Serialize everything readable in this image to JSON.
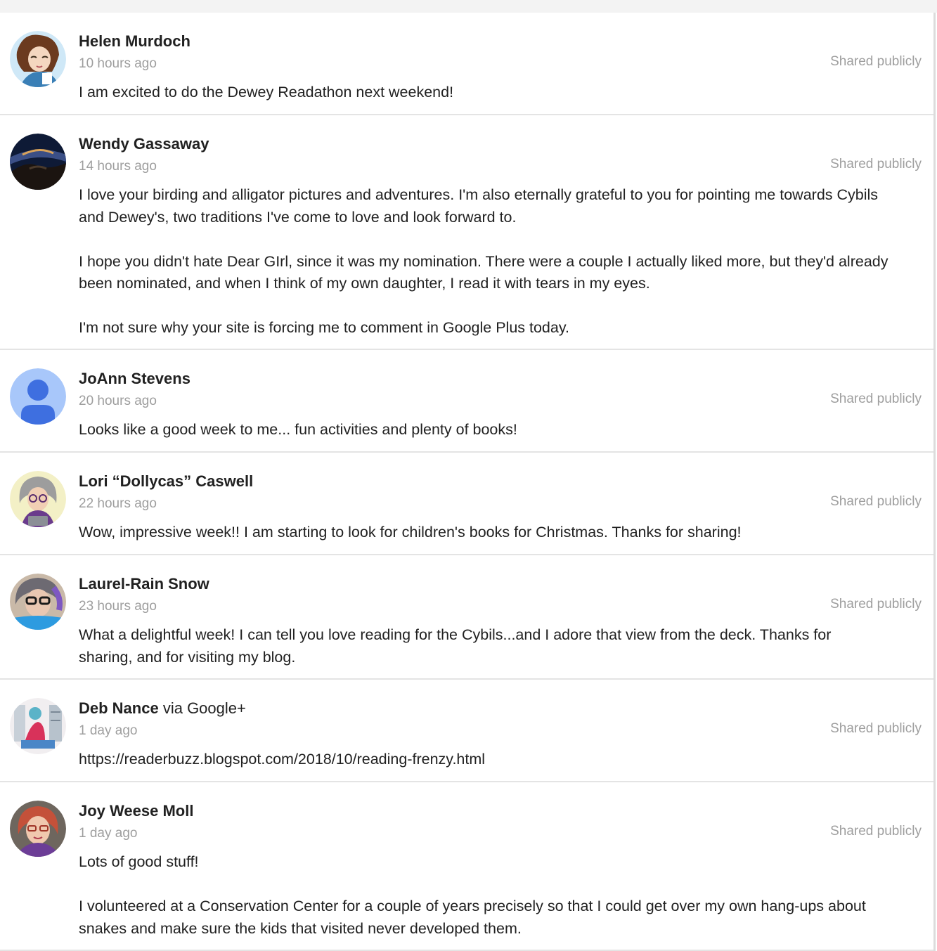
{
  "comments": [
    {
      "author": "Helen Murdoch",
      "time": "10 hours ago",
      "visibility": "Shared publicly",
      "avatar_icon": "cartoon-woman-avatar",
      "paragraphs": [
        [
          "I am excited to do the Dewey Readathon next weekend!"
        ]
      ]
    },
    {
      "author": "Wendy Gassaway",
      "time": "14 hours ago",
      "visibility": "Shared publicly",
      "avatar_icon": "night-landscape-avatar",
      "paragraphs": [
        [
          "I love your birding and alligator pictures and adventures. I'm also eternally grateful to you for pointing me towards Cybils",
          "and Dewey's, two traditions I've come to love and look forward to."
        ],
        [
          "I hope you didn't hate Dear GIrl, since it was my nomination. There were a couple I actually liked more, but they'd already",
          "been nominated, and when I think of my own daughter, I read it with tears in my eyes."
        ],
        [
          "I'm not sure why your site is forcing me to comment in Google Plus today."
        ]
      ]
    },
    {
      "author": "JoAnn Stevens",
      "time": "20 hours ago",
      "visibility": "Shared publicly",
      "avatar_icon": "default-user-avatar",
      "paragraphs": [
        [
          "Looks like a good week to me... fun activities and plenty of books!"
        ]
      ]
    },
    {
      "author": "Lori “Dollycas” Caswell",
      "time": "22 hours ago",
      "visibility": "Shared publicly",
      "avatar_icon": "cartoon-gray-hair-avatar",
      "paragraphs": [
        [
          "Wow, impressive week!! I am starting to look for children's books for Christmas. Thanks for sharing!"
        ]
      ]
    },
    {
      "author": "Laurel-Rain Snow",
      "time": "23 hours ago",
      "visibility": "Shared publicly",
      "avatar_icon": "photo-glasses-avatar",
      "paragraphs": [
        [
          "What a delightful week!  I can tell you love reading for the Cybils...and I adore that view from the deck.  Thanks for",
          "sharing, and for visiting my blog."
        ]
      ]
    },
    {
      "author": "Deb Nance",
      "via": " via Google+",
      "time": "1 day ago",
      "visibility": "Shared publicly",
      "avatar_icon": "illustration-reader-avatar",
      "paragraphs": [
        [
          "https://readerbuzz.blogspot.com/2018/10/reading-frenzy.html"
        ]
      ]
    },
    {
      "author": "Joy Weese Moll",
      "time": "1 day ago",
      "visibility": "Shared publicly",
      "avatar_icon": "photo-red-hair-avatar",
      "paragraphs": [
        [
          "Lots of good stuff!"
        ],
        [
          "I volunteered at a Conservation Center for a couple of years precisely so that I could get over my own hang-ups about",
          "snakes and make sure the kids that visited never developed them."
        ]
      ]
    }
  ]
}
